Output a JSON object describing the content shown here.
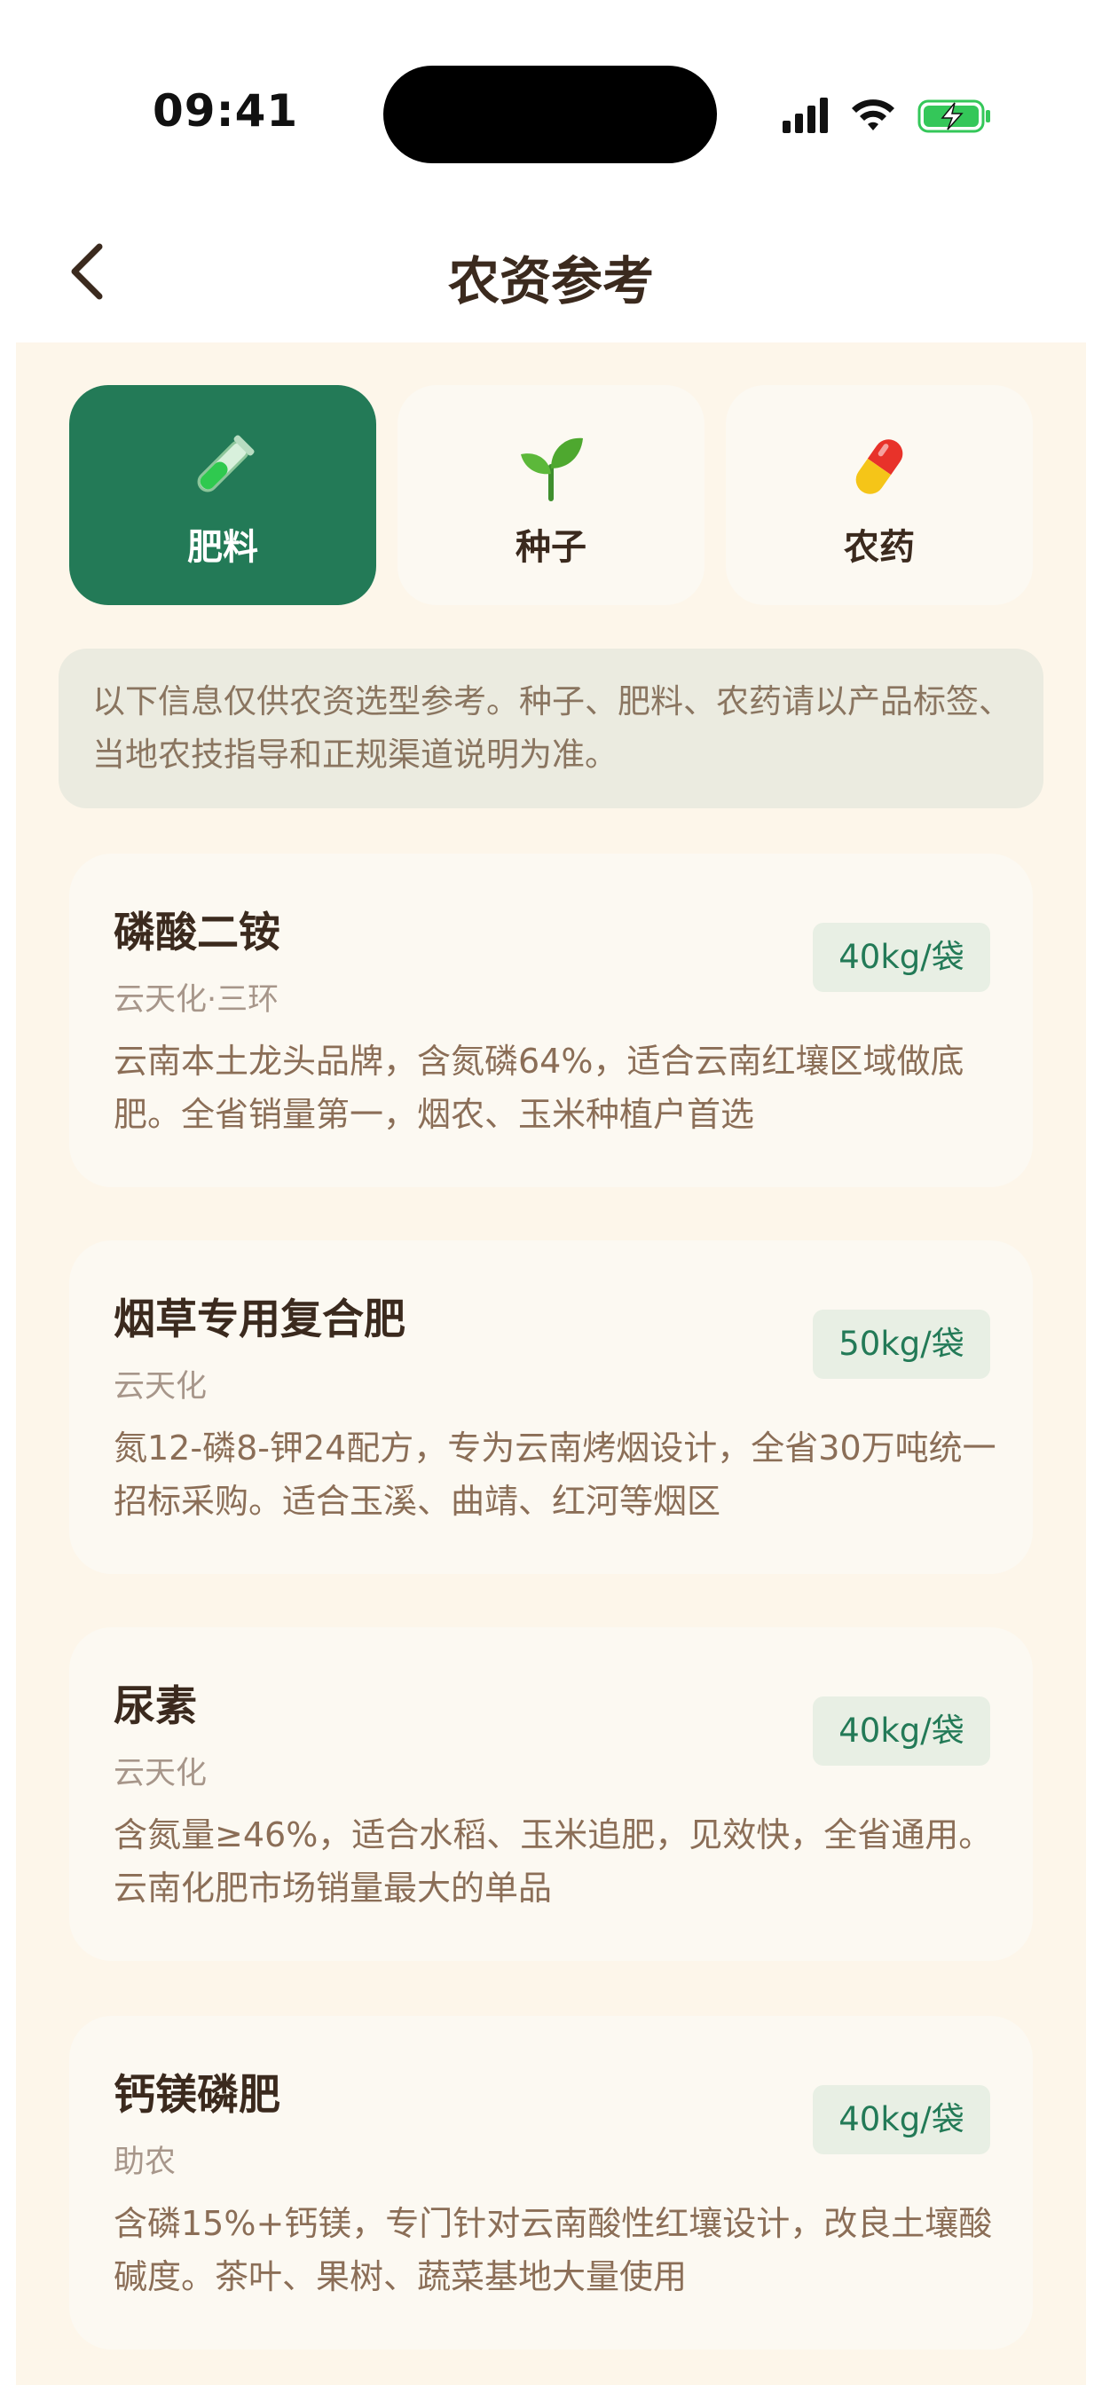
{
  "status_bar": {
    "time": "09:41"
  },
  "header": {
    "title": "农资参考",
    "back_icon": "chevron-left-icon"
  },
  "tabs": [
    {
      "label": "肥料",
      "icon": "test-tube-icon",
      "active": true
    },
    {
      "label": "种子",
      "icon": "seedling-icon",
      "active": false
    },
    {
      "label": "农药",
      "icon": "pill-icon",
      "active": false
    }
  ],
  "notice": {
    "text": "以下信息仅供农资选型参考。种子、肥料、农药请以产品标签、当地农技指导和正规渠道说明为准。"
  },
  "products": [
    {
      "name": "磷酸二铵",
      "brand": "云天化·三环",
      "spec": "40kg/袋",
      "description": "云南本土龙头品牌，含氮磷64%，适合云南红壤区域做底肥。全省销量第一，烟农、玉米种植户首选"
    },
    {
      "name": "烟草专用复合肥",
      "brand": "云天化",
      "spec": "50kg/袋",
      "description": "氮12-磷8-钾24配方，专为云南烤烟设计，全省30万吨统一招标采购。适合玉溪、曲靖、红河等烟区"
    },
    {
      "name": "尿素",
      "brand": "云天化",
      "spec": "40kg/袋",
      "description": "含氮量≥46%，适合水稻、玉米追肥，见效快，全省通用。云南化肥市场销量最大的单品"
    },
    {
      "name": "钙镁磷肥",
      "brand": "助农",
      "spec": "40kg/袋",
      "description": "含磷15%+钙镁，专门针对云南酸性红壤设计，改良土壤酸碱度。茶叶、果树、蔬菜基地大量使用"
    }
  ],
  "colors": {
    "accent": "#237a57",
    "background": "#fdf6ea",
    "card": "#fcf9f2",
    "notice": "#ebebe0",
    "text": "#3b2a1e"
  }
}
